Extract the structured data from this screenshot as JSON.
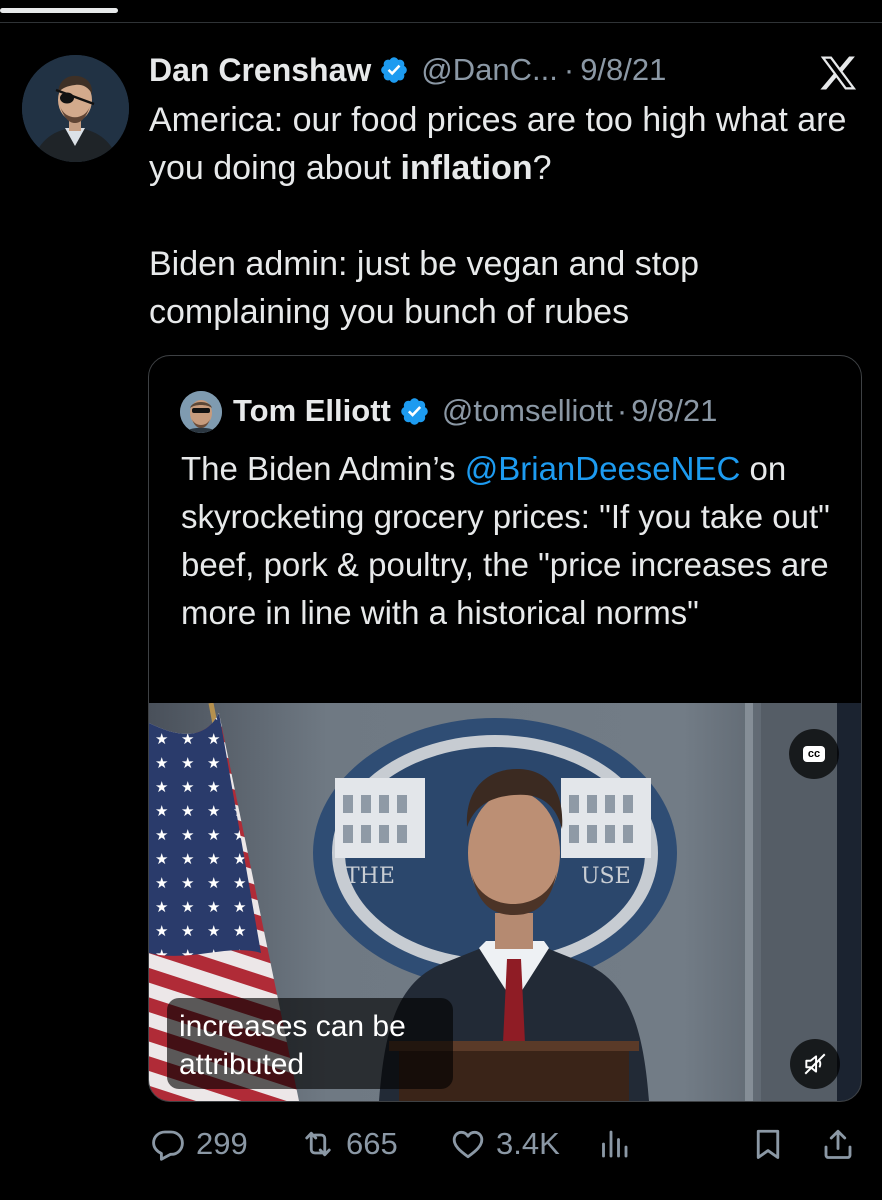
{
  "tweet": {
    "author": {
      "name": "Dan Crenshaw",
      "handle": "@DanC...",
      "avatar": "profile-photo"
    },
    "separator": "·",
    "date": "9/8/21",
    "platform_icon": "x-logo-icon",
    "text": {
      "line1_before": "America: our food prices are too high what are you doing about ",
      "line1_bold": "inflation",
      "line1_after": "?",
      "paragraph2": "Biden admin: just be vegan and stop complaining you bunch of rubes"
    },
    "quote": {
      "author": {
        "name": "Tom Elliott",
        "handle": "@tomselliott",
        "avatar": "profile-photo"
      },
      "separator": "·",
      "date": "9/8/21",
      "text": {
        "before_mention": "The Biden Admin’s ",
        "mention": "@BrianDeeseNEC",
        "after_mention": " on skyrocketing grocery prices: \"If you take out\" beef, pork & poultry, the \"price increases are more in line with a historical norms\""
      },
      "video": {
        "caption": "increases can be attributed",
        "cc_label": "cc",
        "cc_icon": "closed-captions-icon",
        "mute_icon": "speaker-muted-icon",
        "scene_text_left": "THE",
        "scene_text_right": "USE"
      }
    },
    "actions": {
      "replies": "299",
      "reposts": "665",
      "likes": "3.4K",
      "reply_icon": "reply-icon",
      "repost_icon": "repost-icon",
      "like_icon": "heart-icon",
      "views_icon": "views-chart-icon",
      "bookmark_icon": "bookmark-icon",
      "share_icon": "share-icon"
    }
  },
  "colors": {
    "background": "#000000",
    "text_primary": "#e7e9ea",
    "text_secondary": "#8b98a5",
    "link": "#1d9bf0",
    "verified": "#1d9bf0",
    "border": "#3e4144"
  }
}
